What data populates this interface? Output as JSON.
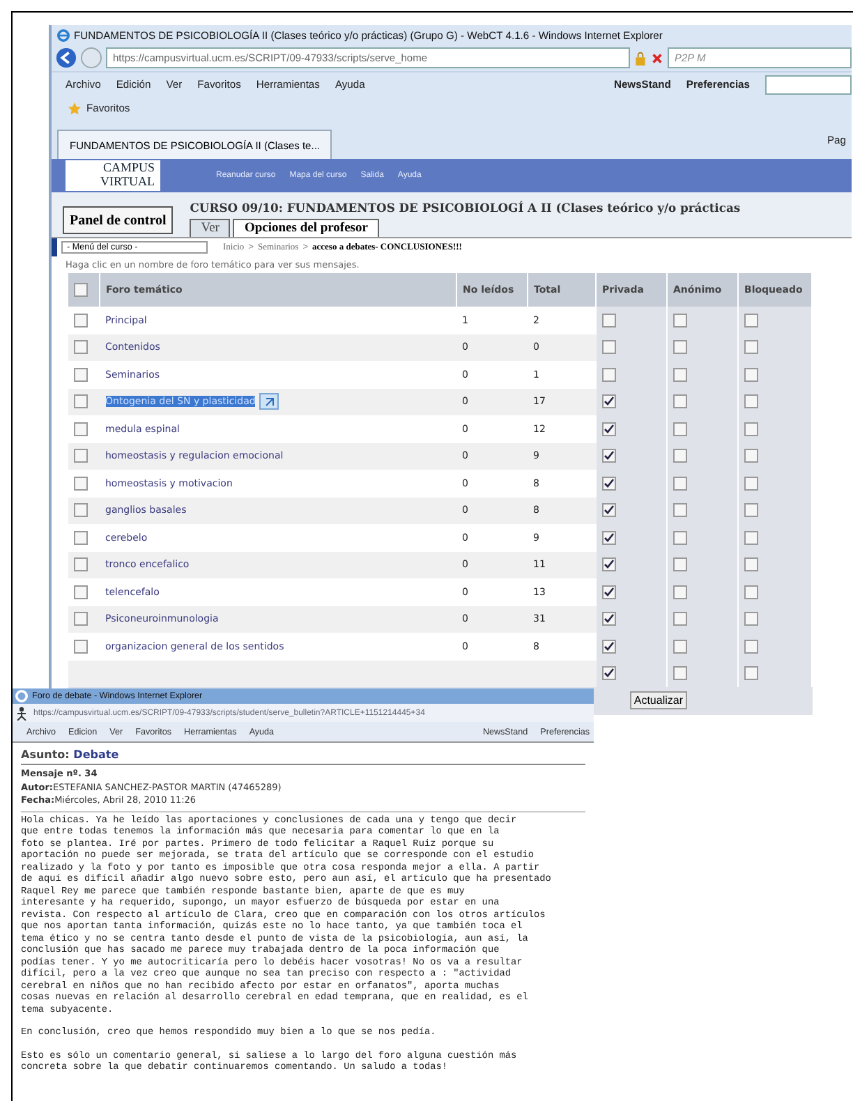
{
  "browser": {
    "title": "FUNDAMENTOS DE PSICOBIOLOGÍA II (Clases teórico y/o prácticas) (Grupo G) - WebCT 4.1.6 - Windows Internet Explorer",
    "address": "https://campusvirtual.ucm.es/SCRIPT/09-47933/scripts/serve_home",
    "search_placeholder": "P2P M",
    "menu": [
      "Archivo",
      "Edición",
      "Ver",
      "Favoritos",
      "Herramientas",
      "Ayuda"
    ],
    "toolbar_items": [
      "NewsStand",
      "Preferencias"
    ],
    "favorites": "Favoritos",
    "tab": "FUNDAMENTOS DE PSICOBIOLOGÍA II (Clases te...",
    "command_bar": "Pag"
  },
  "site": {
    "logo": [
      "CAMPUS",
      "VIRTUAL"
    ],
    "nav": [
      "Reanudar curso",
      "Mapa del curso",
      "Salida",
      "Ayuda"
    ],
    "panel_button": "Panel de control",
    "course_title": "CURSO 09/10: FUNDAMENTOS DE PSICOBIOLOGÍ A II (Clases teórico y/o prácticas",
    "tabs": [
      {
        "label": "Ver",
        "selected": false
      },
      {
        "label": "Opciones del profesor",
        "selected": true
      }
    ],
    "course_menu": "- Menú del curso -",
    "breadcrumb_separator": ">",
    "breadcrumb": [
      "Inicio",
      "Seminarios",
      "acceso a debates- CONCLUSIONES!!!"
    ],
    "hint": "Haga clic en un nombre de foro temático para ver sus mensajes."
  },
  "table": {
    "select_all": false,
    "columns": [
      "Foro temático",
      "No leídos",
      "Total",
      "Privada",
      "Anónimo",
      "Bloqueado"
    ],
    "rows": [
      {
        "name": "Principal",
        "unread": "1",
        "total": "2",
        "selected": false,
        "highlighted": false,
        "privada": false,
        "anonimo": false,
        "bloqueado": false
      },
      {
        "name": "Contenidos",
        "unread": "0",
        "total": "0",
        "selected": false,
        "highlighted": false,
        "privada": false,
        "anonimo": false,
        "bloqueado": false
      },
      {
        "name": "Seminarios",
        "unread": "0",
        "total": "1",
        "selected": false,
        "highlighted": false,
        "privada": false,
        "anonimo": false,
        "bloqueado": false
      },
      {
        "name": "Ontogenia del SN y plasticidad",
        "unread": "0",
        "total": "17",
        "selected": false,
        "highlighted": true,
        "privada": true,
        "anonimo": false,
        "bloqueado": false
      },
      {
        "name": "medula espinal",
        "unread": "0",
        "total": "12",
        "selected": false,
        "highlighted": false,
        "privada": true,
        "anonimo": false,
        "bloqueado": false
      },
      {
        "name": "homeostasis y regulacion emocional",
        "unread": "0",
        "total": "9",
        "selected": false,
        "highlighted": false,
        "privada": true,
        "anonimo": false,
        "bloqueado": false
      },
      {
        "name": "homeostasis y motivacion",
        "unread": "0",
        "total": "8",
        "selected": false,
        "highlighted": false,
        "privada": true,
        "anonimo": false,
        "bloqueado": false
      },
      {
        "name": "ganglios basales",
        "unread": "0",
        "total": "8",
        "selected": false,
        "highlighted": false,
        "privada": true,
        "anonimo": false,
        "bloqueado": false
      },
      {
        "name": "cerebelo",
        "unread": "0",
        "total": "9",
        "selected": false,
        "highlighted": false,
        "privada": true,
        "anonimo": false,
        "bloqueado": false
      },
      {
        "name": "tronco encefalico",
        "unread": "0",
        "total": "11",
        "selected": false,
        "highlighted": false,
        "privada": true,
        "anonimo": false,
        "bloqueado": false
      },
      {
        "name": "telencefalo",
        "unread": "0",
        "total": "13",
        "selected": false,
        "highlighted": false,
        "privada": true,
        "anonimo": false,
        "bloqueado": false
      },
      {
        "name": "Psiconeuroinmunologia",
        "unread": "0",
        "total": "31",
        "selected": false,
        "highlighted": false,
        "privada": true,
        "anonimo": false,
        "bloqueado": false
      },
      {
        "name": "organizacion general de los sentidos",
        "unread": "0",
        "total": "8",
        "selected": false,
        "highlighted": false,
        "privada": true,
        "anonimo": false,
        "bloqueado": false
      },
      {
        "privada": true,
        "anonimo": false,
        "bloqueado": false
      }
    ],
    "button": "Actualizar"
  },
  "popup": {
    "title": "Foro de debate - Windows Internet Explorer",
    "address": "https://campusvirtual.ucm.es/SCRIPT/09-47933/scripts/student/serve_bulletin?ARTICLE+1151214445+34",
    "menu": [
      "Archivo",
      "Edicion",
      "Ver",
      "Favoritos",
      "Herramientas",
      "Ayuda"
    ],
    "toolbar_items": [
      "NewsStand",
      "Preferencias"
    ],
    "subject_label": "Asunto:",
    "subject": "Debate",
    "fields": [
      {
        "label": "Mensaje nº. 34"
      },
      {
        "label": "Autor:",
        "value": "ESTEFANIA SANCHEZ-PASTOR MARTIN (47465289)"
      },
      {
        "label": "Fecha:",
        "value": "Miércoles, Abril 28, 2010 11:26"
      }
    ],
    "body": [
      "Hola chicas. Ya he leído las aportaciones y conclusiones de cada una y tengo que decir\nque entre todas tenemos la información más que necesaria para comentar lo que en la\nfoto se plantea. Iré por partes. Primero de todo felicitar a Raquel Ruiz porque su\naportación no puede ser mejorada, se trata del artículo que se corresponde con el estudio\nrealizado y la foto y por tanto es imposible que otra cosa responda mejor a ella. A partir\nde aquí es difícil añadir algo nuevo sobre esto, pero aun así, el artículo que ha presentado\nRaquel Rey me parece que también responde bastante bien, aparte de que es muy\ninteresante y ha requerido, supongo, un mayor esfuerzo de búsqueda por estar en una\nrevista. Con respecto al artículo de Clara, creo que en comparación con los otros artículos\nque nos aportan tanta información, quizás este no lo hace tanto, ya que también toca el\ntema ético y no se centra tanto desde el punto de vista de la psicobiología, aun así, la\nconclusión que has sacado me parece muy trabajada dentro de la poca información que\npodías tener. Y yo me autocriticaría pero lo debéis hacer vosotras! No os va a resultar\ndifícil, pero a la vez creo que aunque no sea tan preciso con respecto a : \"actividad\ncerebral en niños que no han recibido afecto por estar en orfanatos\", aporta muchas\ncosas nuevas en relación al desarrollo cerebral en edad temprana, que en realidad, es el\ntema subyacente.",
      "En conclusión, creo que hemos respondido muy bien a lo que se nos pedía.",
      "Esto es sólo un comentario general, si saliese a lo largo del foro alguna cuestión más\nconcreta sobre la que debatir continuaremos comentando. Un saludo a todas!"
    ]
  }
}
